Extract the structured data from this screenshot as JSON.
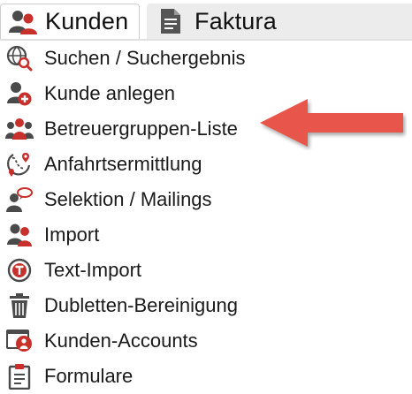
{
  "tabs": [
    {
      "label": "Kunden",
      "icon": "users-icon",
      "active": true
    },
    {
      "label": "Faktura",
      "icon": "document-icon",
      "active": false
    }
  ],
  "menu": [
    {
      "label": "Suchen / Suchergebnis",
      "icon": "globe-search-icon"
    },
    {
      "label": "Kunde anlegen",
      "icon": "user-add-icon"
    },
    {
      "label": "Betreuergruppen-Liste",
      "icon": "group-icon"
    },
    {
      "label": "Anfahrtsermittlung",
      "icon": "route-icon"
    },
    {
      "label": "Selektion / Mailings",
      "icon": "user-speech-icon"
    },
    {
      "label": "Import",
      "icon": "users-import-icon"
    },
    {
      "label": "Text-Import",
      "icon": "text-circle-icon"
    },
    {
      "label": "Dubletten-Bereinigung",
      "icon": "trash-icon"
    },
    {
      "label": "Kunden-Accounts",
      "icon": "user-window-icon"
    },
    {
      "label": "Formulare",
      "icon": "clipboard-icon"
    }
  ],
  "colors": {
    "accent_red": "#c8302c",
    "dark_icon": "#4a4a4a",
    "arrow": "#e8574c"
  }
}
